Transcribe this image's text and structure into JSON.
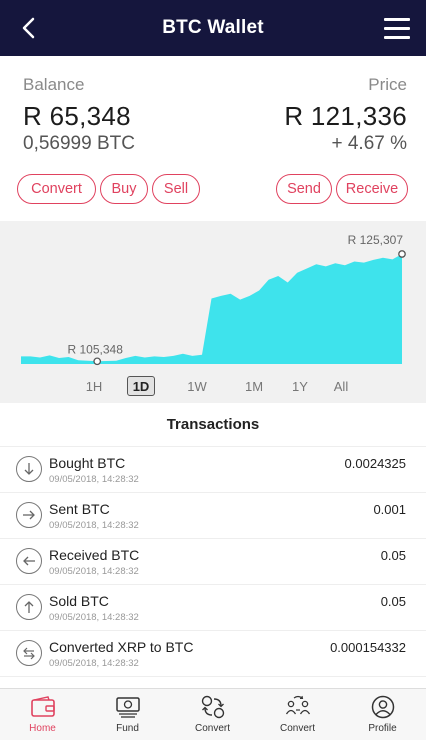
{
  "header": {
    "title": "BTC Wallet",
    "back_icon": "chevron-left-icon",
    "menu_icon": "hamburger-menu-icon"
  },
  "summary": {
    "balance_label": "Balance",
    "balance_zar": "R 65,348",
    "balance_btc": "0,56999 BTC",
    "price_label": "Price",
    "price_zar": "R 121,336",
    "price_change": "+ 4.67 %"
  },
  "actions": {
    "convert": "Convert",
    "buy": "Buy",
    "sell": "Sell",
    "send": "Send",
    "receive": "Receive"
  },
  "chart_data": {
    "type": "area",
    "x": [
      0,
      1,
      2,
      3,
      4,
      5,
      6,
      7,
      8,
      9,
      10,
      11,
      12,
      13,
      14,
      15,
      16,
      17,
      18,
      19,
      20,
      21,
      22,
      23,
      24,
      25,
      26,
      27,
      28,
      29,
      30,
      31,
      32,
      33,
      34,
      35,
      36,
      37,
      38,
      39,
      40
    ],
    "values": [
      106200,
      106200,
      106000,
      106400,
      105900,
      106100,
      105500,
      105400,
      105300,
      105348,
      105400,
      105900,
      106300,
      106000,
      106200,
      106100,
      106300,
      106700,
      106300,
      106500,
      117000,
      117500,
      117900,
      116800,
      117500,
      118500,
      120500,
      121200,
      120000,
      121800,
      122600,
      123400,
      123000,
      123600,
      123200,
      123900,
      123700,
      124200,
      124600,
      124300,
      125307
    ],
    "labels": {
      "min": "R 105,348",
      "max": "R 125,307"
    },
    "fill_color": "#3ee3ec",
    "background_color": "#f1f1f1",
    "grid": false,
    "ranges": [
      "1H",
      "1D",
      "1W",
      "1M",
      "1Y",
      "All"
    ],
    "active_range": "1D"
  },
  "transactions": {
    "title": "Transactions",
    "items": [
      {
        "name": "Bought BTC",
        "date": "09/05/2018, 14:28:32",
        "amount": "0.0024325",
        "icon": "arrow-down-circle-icon"
      },
      {
        "name": "Sent BTC",
        "date": "09/05/2018, 14:28:32",
        "amount": "0.001",
        "icon": "arrow-right-circle-icon"
      },
      {
        "name": "Received BTC",
        "date": "09/05/2018, 14:28:32",
        "amount": "0.05",
        "icon": "arrow-left-circle-icon"
      },
      {
        "name": "Sold BTC",
        "date": "09/05/2018, 14:28:32",
        "amount": "0.05",
        "icon": "arrow-up-circle-icon"
      },
      {
        "name": "Converted XRP to BTC",
        "date": "09/05/2018, 14:28:32",
        "amount": "0.000154332",
        "icon": "swap-circle-icon"
      }
    ]
  },
  "tabbar": {
    "items": [
      {
        "label": "Home",
        "icon": "wallet-icon",
        "active": true
      },
      {
        "label": "Fund",
        "icon": "banknote-icon",
        "active": false
      },
      {
        "label": "Convert",
        "icon": "convert-coins-icon",
        "active": false
      },
      {
        "label": "Convert",
        "icon": "people-exchange-icon",
        "active": false
      },
      {
        "label": "Profile",
        "icon": "profile-icon",
        "active": false
      }
    ],
    "accent": "#e0425f"
  },
  "colors": {
    "header_bg": "#15163d",
    "accent": "#e0425f",
    "chart_fill": "#3ee3ec"
  }
}
